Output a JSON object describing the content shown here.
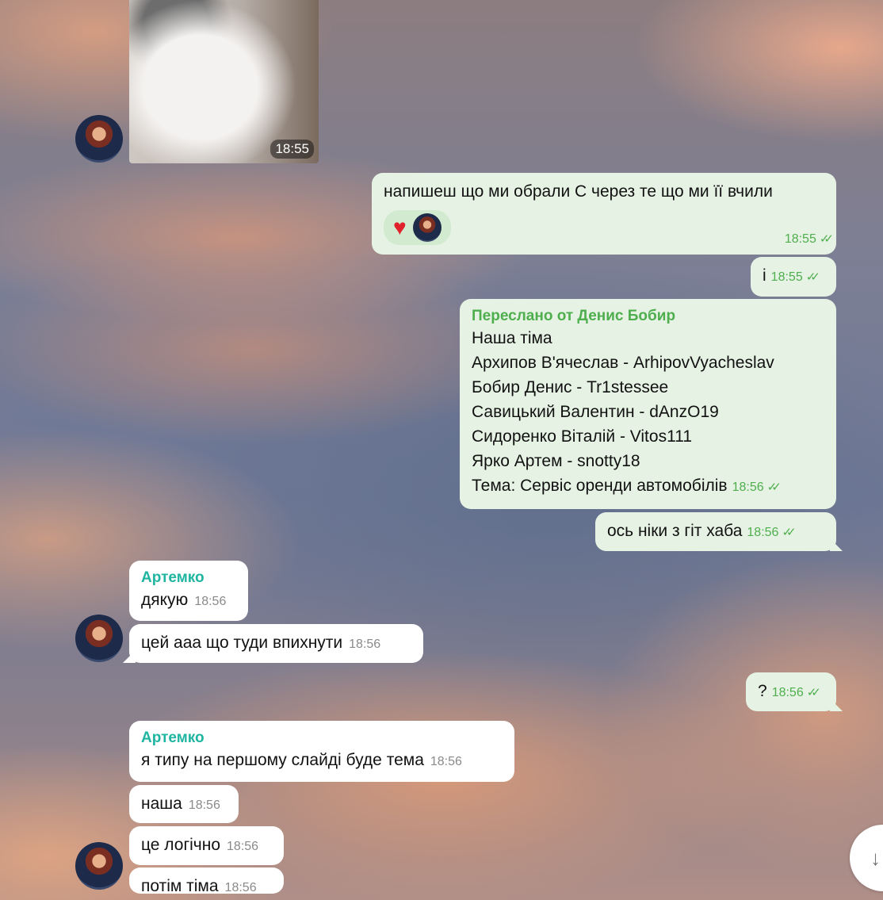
{
  "messages": {
    "photo": {
      "time": "18:55"
    },
    "m1": {
      "text": "напишеш що ми обрали С через те що ми її вчили",
      "time": "18:55",
      "reaction": "heart-emoji"
    },
    "m2": {
      "text": "і",
      "time": "18:55"
    },
    "m3": {
      "forwarded": "Переслано от Денис Бобир",
      "lines": [
        "Наша тіма",
        "Архипов В'ячеслав - ArhipovVyacheslav",
        "Бобир Денис - Tr1stessee",
        "Савицький Валентин - dAnzO19",
        "Сидоренко Віталій - Vitos111",
        "Ярко Артем - snotty18",
        "Тема: Сервіс оренди автомобілів"
      ],
      "time": "18:56"
    },
    "m4": {
      "text": "ось ніки з гіт хаба",
      "time": "18:56"
    },
    "m5": {
      "sender": "Артемко",
      "text": "дякую",
      "time": "18:56"
    },
    "m6": {
      "text": "цей ааа що туди впихнути",
      "time": "18:56"
    },
    "m7": {
      "text": "?",
      "time": "18:56"
    },
    "m8": {
      "sender": "Артемко",
      "text": "я типу на першому слайді буде тема",
      "time": "18:56"
    },
    "m9": {
      "text": "наша",
      "time": "18:56"
    },
    "m10": {
      "text": "це логічно",
      "time": "18:56"
    },
    "m11": {
      "text": "потім тіма",
      "time": "18:56"
    }
  },
  "ticks": "✓✓",
  "scroll_button": {
    "icon": "arrow-down-icon",
    "glyph": "↓"
  },
  "colors": {
    "outgoing": "#e6f3e4",
    "incoming": "#ffffff",
    "accent_green": "#4fae4e",
    "sender_teal": "#1fb5a0"
  }
}
